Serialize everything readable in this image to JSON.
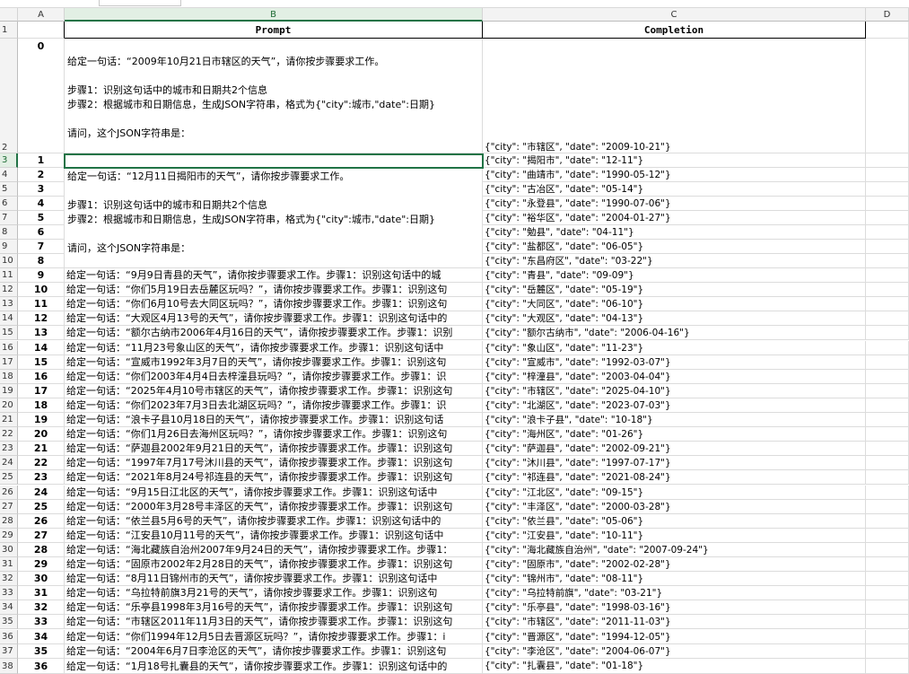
{
  "columns": [
    "A",
    "B",
    "C",
    "D"
  ],
  "header_row": {
    "prompt": "Prompt",
    "completion": "Completion"
  },
  "row0": {
    "index": "0",
    "lines": [
      "给定一句话：“2009年10月21日市辖区的天气”，请你按步骤要求工作。",
      "",
      "步骤1：识别这句话中的城市和日期共2个信息",
      "步骤2：根据城市和日期信息，生成JSON字符串，格式为{\"city\":城市,\"date\":日期}",
      "",
      "请问，这个JSON字符串是："
    ],
    "completion": "{\"city\": \"市辖区\", \"date\": \"2009-10-21\"}"
  },
  "row1_prompt_lines": [
    "",
    "给定一句话：“12月11日揭阳市的天气”，请你按步骤要求工作。",
    "",
    "步骤1：识别这句话中的城市和日期共2个信息",
    "步骤2：根据城市和日期信息，生成JSON字符串，格式为{\"city\":城市,\"date\":日期}",
    "",
    "请问，这个JSON字符串是：",
    ""
  ],
  "row_numbers": [
    "1",
    "2",
    "3",
    "4",
    "5",
    "6",
    "7",
    "8",
    "9",
    "10",
    "11",
    "12",
    "13",
    "14",
    "15",
    "16",
    "17",
    "18",
    "19",
    "20",
    "21",
    "22",
    "23",
    "24",
    "25",
    "26",
    "27",
    "28",
    "29",
    "30",
    "31",
    "32",
    "33",
    "34",
    "35",
    "36",
    "37",
    "38"
  ],
  "rows": [
    {
      "a": "1",
      "b": "",
      "c": "{\"city\": \"揭阳市\", \"date\": \"12-11\"}"
    },
    {
      "a": "2",
      "b": "",
      "c": "{\"city\": \"曲靖市\", \"date\": \"1990-05-12\"}"
    },
    {
      "a": "3",
      "b": "",
      "c": "{\"city\": \"古冶区\", \"date\": \"05-14\"}"
    },
    {
      "a": "4",
      "b": "",
      "c": "{\"city\": \"永登县\", \"date\": \"1990-07-06\"}"
    },
    {
      "a": "5",
      "b": "",
      "c": "{\"city\": \"裕华区\", \"date\": \"2004-01-27\"}"
    },
    {
      "a": "6",
      "b": "",
      "c": "{\"city\": \"勉县\", \"date\": \"04-11\"}"
    },
    {
      "a": "7",
      "b": "",
      "c": "{\"city\": \"盐都区\", \"date\": \"06-05\"}"
    },
    {
      "a": "8",
      "b": "",
      "c": "{\"city\": \"东昌府区\", \"date\": \"03-22\"}"
    },
    {
      "a": "9",
      "b": "给定一句话：“9月9日青县的天气”，请你按步骤要求工作。步骤1：识别这句话中的城",
      "c": "{\"city\": \"青县\", \"date\": \"09-09\"}"
    },
    {
      "a": "10",
      "b": "给定一句话：“你们5月19日去岳麓区玩吗？”，请你按步骤要求工作。步骤1：识别这句",
      "c": "{\"city\": \"岳麓区\", \"date\": \"05-19\"}"
    },
    {
      "a": "11",
      "b": "给定一句话：“你们6月10号去大同区玩吗？”，请你按步骤要求工作。步骤1：识别这句",
      "c": "{\"city\": \"大同区\", \"date\": \"06-10\"}"
    },
    {
      "a": "12",
      "b": "给定一句话：“大观区4月13号的天气”，请你按步骤要求工作。步骤1：识别这句话中的",
      "c": "{\"city\": \"大观区\", \"date\": \"04-13\"}"
    },
    {
      "a": "13",
      "b": "给定一句话：“额尔古纳市2006年4月16日的天气”，请你按步骤要求工作。步骤1：识别",
      "c": "{\"city\": \"额尔古纳市\", \"date\": \"2006-04-16\"}"
    },
    {
      "a": "14",
      "b": "给定一句话：“11月23号象山区的天气”，请你按步骤要求工作。步骤1：识别这句话中",
      "c": "{\"city\": \"象山区\", \"date\": \"11-23\"}"
    },
    {
      "a": "15",
      "b": "给定一句话：“宣威市1992年3月7日的天气”，请你按步骤要求工作。步骤1：识别这句",
      "c": "{\"city\": \"宣威市\", \"date\": \"1992-03-07\"}"
    },
    {
      "a": "16",
      "b": "给定一句话：“你们2003年4月4日去梓潼县玩吗？”，请你按步骤要求工作。步骤1：识",
      "c": "{\"city\": \"梓潼县\", \"date\": \"2003-04-04\"}"
    },
    {
      "a": "17",
      "b": "给定一句话：“2025年4月10号市辖区的天气”，请你按步骤要求工作。步骤1：识别这句",
      "c": "{\"city\": \"市辖区\", \"date\": \"2025-04-10\"}"
    },
    {
      "a": "18",
      "b": "给定一句话：“你们2023年7月3日去北湖区玩吗？”，请你按步骤要求工作。步骤1：识",
      "c": "{\"city\": \"北湖区\", \"date\": \"2023-07-03\"}"
    },
    {
      "a": "19",
      "b": "给定一句话：“浪卡子县10月18日的天气”，请你按步骤要求工作。步骤1：识别这句话",
      "c": "{\"city\": \"浪卡子县\", \"date\": \"10-18\"}"
    },
    {
      "a": "20",
      "b": "给定一句话：“你们1月26日去海州区玩吗？”，请你按步骤要求工作。步骤1：识别这句",
      "c": "{\"city\": \"海州区\", \"date\": \"01-26\"}"
    },
    {
      "a": "21",
      "b": "给定一句话：“萨迦县2002年9月21日的天气”，请你按步骤要求工作。步骤1：识别这句",
      "c": "{\"city\": \"萨迦县\", \"date\": \"2002-09-21\"}"
    },
    {
      "a": "22",
      "b": "给定一句话：“1997年7月17号沐川县的天气”，请你按步骤要求工作。步骤1：识别这句",
      "c": "{\"city\": \"沐川县\", \"date\": \"1997-07-17\"}"
    },
    {
      "a": "23",
      "b": "给定一句话：“2021年8月24号祁连县的天气”，请你按步骤要求工作。步骤1：识别这句",
      "c": "{\"city\": \"祁连县\", \"date\": \"2021-08-24\"}"
    },
    {
      "a": "24",
      "b": "给定一句话：“9月15日江北区的天气”，请你按步骤要求工作。步骤1：识别这句话中",
      "c": "{\"city\": \"江北区\", \"date\": \"09-15\"}"
    },
    {
      "a": "25",
      "b": "给定一句话：“2000年3月28号丰泽区的天气”，请你按步骤要求工作。步骤1：识别这句",
      "c": "{\"city\": \"丰泽区\", \"date\": \"2000-03-28\"}"
    },
    {
      "a": "26",
      "b": "给定一句话：“依兰县5月6号的天气”，请你按步骤要求工作。步骤1：识别这句话中的",
      "c": "{\"city\": \"依兰县\", \"date\": \"05-06\"}"
    },
    {
      "a": "27",
      "b": "给定一句话：“江安县10月11号的天气”，请你按步骤要求工作。步骤1：识别这句话中",
      "c": "{\"city\": \"江安县\", \"date\": \"10-11\"}"
    },
    {
      "a": "28",
      "b": "给定一句话：“海北藏族自治州2007年9月24日的天气”，请你按步骤要求工作。步骤1：",
      "c": "{\"city\": \"海北藏族自治州\", \"date\": \"2007-09-24\"}"
    },
    {
      "a": "29",
      "b": "给定一句话：“固原市2002年2月28日的天气”，请你按步骤要求工作。步骤1：识别这句",
      "c": "{\"city\": \"固原市\", \"date\": \"2002-02-28\"}"
    },
    {
      "a": "30",
      "b": "给定一句话：“8月11日锦州市的天气”，请你按步骤要求工作。步骤1：识别这句话中",
      "c": "{\"city\": \"锦州市\", \"date\": \"08-11\"}"
    },
    {
      "a": "31",
      "b": "给定一句话：“乌拉特前旗3月21号的天气”，请你按步骤要求工作。步骤1：识别这句",
      "c": "{\"city\": \"乌拉特前旗\", \"date\": \"03-21\"}"
    },
    {
      "a": "32",
      "b": "给定一句话：“乐亭县1998年3月16号的天气”，请你按步骤要求工作。步骤1：识别这句",
      "c": "{\"city\": \"乐亭县\", \"date\": \"1998-03-16\"}"
    },
    {
      "a": "33",
      "b": "给定一句话：“市辖区2011年11月3日的天气”，请你按步骤要求工作。步骤1：识别这句",
      "c": "{\"city\": \"市辖区\", \"date\": \"2011-11-03\"}"
    },
    {
      "a": "34",
      "b": "给定一句话：“你们1994年12月5日去晋源区玩吗？”，请你按步骤要求工作。步骤1：i",
      "c": "{\"city\": \"晋源区\", \"date\": \"1994-12-05\"}"
    },
    {
      "a": "35",
      "b": "给定一句话：“2004年6月7日李沧区的天气”，请你按步骤要求工作。步骤1：识别这句",
      "c": "{\"city\": \"李沧区\", \"date\": \"2004-06-07\"}"
    },
    {
      "a": "36",
      "b": "给定一句话：“1月18号扎囊县的天气”，请你按步骤要求工作。步骤1：识别这句话中的",
      "c": "{\"city\": \"扎囊县\", \"date\": \"01-18\"}"
    }
  ]
}
